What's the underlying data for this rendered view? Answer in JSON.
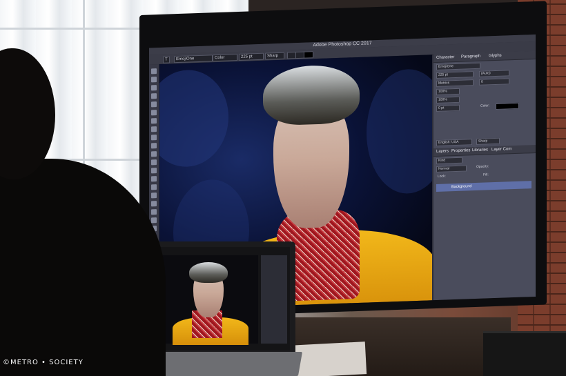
{
  "tv": {
    "app_title": "Adobe Photoshop CC 2017",
    "options_bar": {
      "font_family": "EmojiOne",
      "font_style": "Color",
      "font_size": "225 pt",
      "antialias": "Sharp"
    },
    "character_panel": {
      "tabs": [
        "Character",
        "Paragraph",
        "Glyphs"
      ],
      "font": "EmojiOne",
      "size": "225 pt",
      "leading": "(Auto)",
      "kerning": "Metrics",
      "tracking": "0",
      "vertical_scale": "100%",
      "horizontal_scale": "100%",
      "baseline": "0 pt",
      "color_label": "Color:",
      "language": "English: USA",
      "antialias": "Sharp"
    },
    "layers_panel": {
      "tabs": [
        "Layers",
        "Properties",
        "Libraries",
        "Layer Com"
      ],
      "filter": "Kind",
      "blend_mode": "Normal",
      "opacity_label": "Opacity:",
      "lock_label": "Lock:",
      "fill_label": "Fill:",
      "layer_name": "Background"
    }
  },
  "watermark": "©METRO • SOCIETY",
  "colors": {
    "ps_background": "#2e2f3b",
    "panel": "#4a4c5c",
    "selected_layer": "#5f6fa8",
    "jacket": "#f2b81a",
    "scarf": "#a0171f"
  }
}
